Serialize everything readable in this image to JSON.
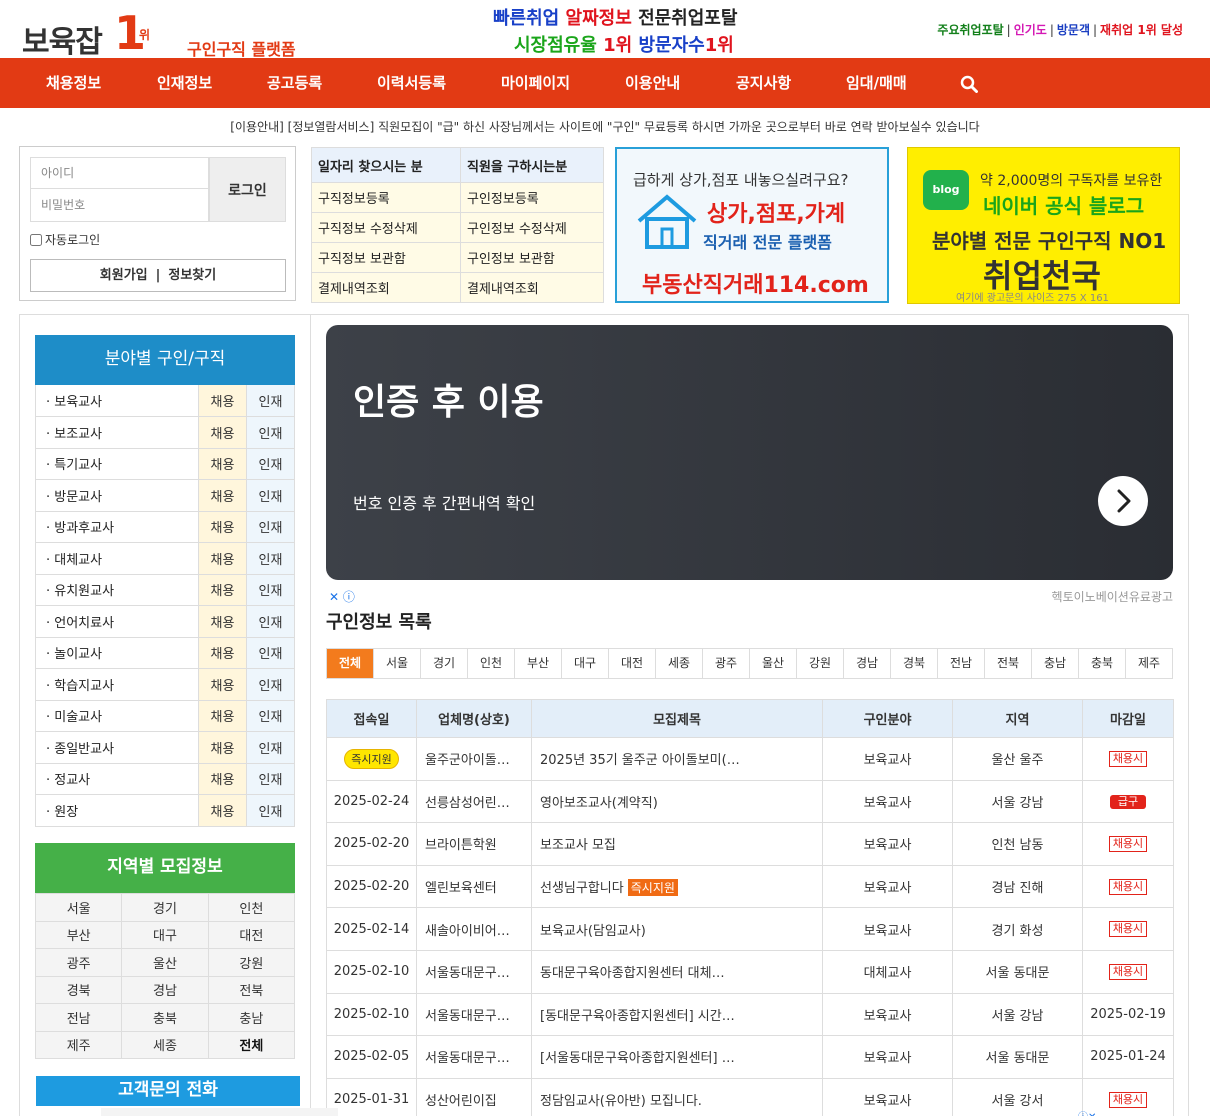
{
  "header": {
    "logo_text": "보육잡",
    "logo_rank": "1",
    "logo_rank_suffix": "위",
    "logo_sub": "구인구직 플랫폼",
    "slogan_line1_a": "빠른취업",
    "slogan_line1_b": "알짜정보",
    "slogan_line1_c": "전문취업포탈",
    "slogan_line2_a": "시장점유율",
    "slogan_line2_b": "1위",
    "slogan_line2_c": "방문자수",
    "slogan_line2_d": "1위",
    "toplinks": [
      "주요취업포탈",
      "인기도",
      "방문객",
      "재취업 1위 달성"
    ]
  },
  "nav": {
    "items": [
      "채용정보",
      "인재정보",
      "공고등록",
      "이력서등록",
      "마이페이지",
      "이용안내",
      "공지사항",
      "임대/매매"
    ]
  },
  "notice": "[이용안내] [정보열람서비스] 직원모집이 \"급\" 하신 사장님께서는 사이트에 \"구인\" 무료등록 하시면 가까운 곳으로부터 바로 연락 받아보실수 있습니다",
  "login": {
    "id_placeholder": "아이디",
    "pw_placeholder": "비밀번호",
    "login_button": "로그인",
    "auto_login": "자동로그인",
    "join": "회원가입",
    "find": "정보찾기",
    "separator": "|"
  },
  "service": {
    "col1_header": "일자리 찾으시는 분",
    "col2_header": "직원을 구하시는분",
    "rows": [
      [
        "구직정보등록",
        "구인정보등록"
      ],
      [
        "구직정보 수정삭제",
        "구인정보 수정삭제"
      ],
      [
        "구직정보 보관함",
        "구인정보 보관함"
      ],
      [
        "결제내역조회",
        "결제내역조회"
      ]
    ]
  },
  "ad_house": {
    "line1": "급하게 상가,점포 내놓으실려구요?",
    "line2": "상가,점포,가계",
    "line3": "직거래 전문 플랫폼",
    "line4": "부동산직거래114.com",
    "accent": "#28a0d8"
  },
  "ad_blog": {
    "icon_label": "blog",
    "line1": "약 2,000명의 구독자를 보유한",
    "line2": "네이버 공식 블로그",
    "line3": "분야별 전문 구인구직 NO1",
    "line4": "취업천국",
    "line5": "여기에 광고문의 사이즈 275 X 161"
  },
  "category": {
    "title": "분야별 구인/구직",
    "hire_label": "채용",
    "talent_label": "인재",
    "items": [
      "보육교사",
      "보조교사",
      "특기교사",
      "방문교사",
      "방과후교사",
      "대체교사",
      "유치원교사",
      "언어치료사",
      "놀이교사",
      "학습지교사",
      "미술교사",
      "종일반교사",
      "정교사",
      "원장"
    ]
  },
  "region_box": {
    "title": "지역별 모집정보",
    "rows": [
      [
        "서울",
        "경기",
        "인천"
      ],
      [
        "부산",
        "대구",
        "대전"
      ],
      [
        "광주",
        "울산",
        "강원"
      ],
      [
        "경북",
        "경남",
        "전북"
      ],
      [
        "전남",
        "충북",
        "충남"
      ],
      [
        "제주",
        "세종",
        "전체"
      ]
    ]
  },
  "customer_center": {
    "title": "고객문의 전화"
  },
  "banner": {
    "title": "인증 후 이용",
    "subtitle": "번호 인증 후 간편내역 확인"
  },
  "ad_label": "헥토이노베이션유료광고",
  "list": {
    "title": "구인정보 목록",
    "tabs": [
      "전체",
      "서울",
      "경기",
      "인천",
      "부산",
      "대구",
      "대전",
      "세종",
      "광주",
      "울산",
      "강원",
      "경남",
      "경북",
      "전남",
      "전북",
      "충남",
      "충북",
      "제주"
    ],
    "active_tab": "전체",
    "columns": [
      "접속일",
      "업체명(상호)",
      "모집제목",
      "구인분야",
      "지역",
      "마감일"
    ],
    "rows": [
      {
        "date": "즉시지원",
        "date_badge": true,
        "company": "울주군아이돌…",
        "title": "2025년 35기 울주군 아이돌보미(…",
        "title_badge": "",
        "field": "보육교사",
        "region": "울산 울주",
        "deadline": "채용시",
        "deadline_type": "until"
      },
      {
        "date": "2025-02-24",
        "date_badge": false,
        "company": "선릉삼성어린…",
        "title": "영아보조교사(계약직)",
        "title_badge": "",
        "field": "보육교사",
        "region": "서울 강남",
        "deadline": "급구",
        "deadline_type": "hurry"
      },
      {
        "date": "2025-02-20",
        "date_badge": false,
        "company": "브라이튼학원",
        "title": "보조교사 모집",
        "title_badge": "",
        "field": "보육교사",
        "region": "인천 남동",
        "deadline": "채용시",
        "deadline_type": "until"
      },
      {
        "date": "2025-02-20",
        "date_badge": false,
        "company": "엘린보육센터",
        "title": "선생님구합니다",
        "title_badge": "즉시지원",
        "field": "보육교사",
        "region": "경남 진해",
        "deadline": "채용시",
        "deadline_type": "until"
      },
      {
        "date": "2025-02-14",
        "date_badge": false,
        "company": "새솔아이비어…",
        "title": "보육교사(담임교사)",
        "title_badge": "",
        "field": "보육교사",
        "region": "경기 화성",
        "deadline": "채용시",
        "deadline_type": "until"
      },
      {
        "date": "2025-02-10",
        "date_badge": false,
        "company": "서울동대문구…",
        "title": "동대문구육아종합지원센터 대체…",
        "title_badge": "",
        "field": "대체교사",
        "region": "서울 동대문",
        "deadline": "채용시",
        "deadline_type": "until"
      },
      {
        "date": "2025-02-10",
        "date_badge": false,
        "company": "서울동대문구…",
        "title": "[동대문구육아종합지원센터] 시간…",
        "title_badge": "",
        "field": "보육교사",
        "region": "서울 강남",
        "deadline": "2025-02-19",
        "deadline_type": "text"
      },
      {
        "date": "2025-02-05",
        "date_badge": false,
        "company": "서울동대문구…",
        "title": "[서울동대문구육아종합지원센터] …",
        "title_badge": "",
        "field": "보육교사",
        "region": "서울 동대문",
        "deadline": "2025-01-24",
        "deadline_type": "text"
      },
      {
        "date": "2025-01-31",
        "date_badge": false,
        "company": "성산어린이집",
        "title": "정담임교사(유아반) 모집니다.",
        "title_badge": "",
        "field": "보육교사",
        "region": "서울 강서",
        "deadline": "채용시",
        "deadline_type": "until"
      }
    ]
  },
  "colors": {
    "brand_red": "#e23a14",
    "category_blue": "#1e8dc8",
    "region_green": "#45b048",
    "active_tab_orange": "#f37b1d"
  }
}
